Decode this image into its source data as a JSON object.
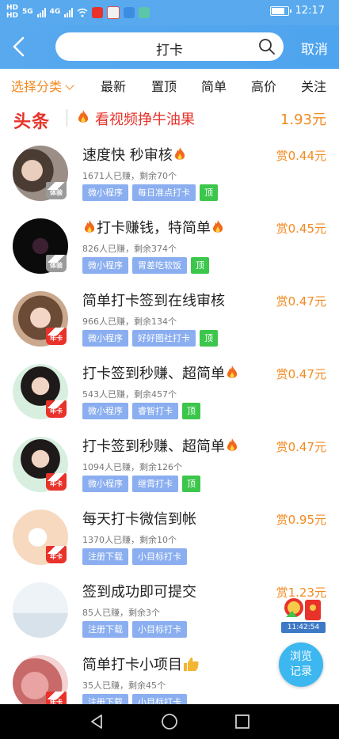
{
  "status_bar": {
    "sim1": "HD",
    "sim2": "HD",
    "net1": "5G",
    "net2": "4G",
    "time": "12:17"
  },
  "header": {
    "search_text": "打卡",
    "cancel_label": "取消"
  },
  "tabs": [
    {
      "label": "选择分类",
      "active": true
    },
    {
      "label": "最新"
    },
    {
      "label": "置顶"
    },
    {
      "label": "简单"
    },
    {
      "label": "高价"
    },
    {
      "label": "关注"
    }
  ],
  "headline": {
    "tag": "头条",
    "title": "看视频挣牛油果",
    "price": "1.93元"
  },
  "tasks": [
    {
      "title": "速度快 秒审核",
      "fire_after": true,
      "reward": "赏0.44元",
      "meta": "1671人已赚，剩余70个",
      "tags": [
        "微小程序",
        "每日准点打卡"
      ],
      "top": "顶",
      "badge": "体验",
      "badge_color": "gray"
    },
    {
      "title": "打卡赚钱，特简单",
      "fire_before": true,
      "fire_after": true,
      "reward": "赏0.45元",
      "meta": "826人已赚，剩余374个",
      "tags": [
        "微小程序",
        "胃差吃软饭"
      ],
      "top": "顶",
      "badge": "体验",
      "badge_color": "gray"
    },
    {
      "title": "简单打卡签到在线审核",
      "reward": "赏0.47元",
      "meta": "966人已赚，剩余134个",
      "tags": [
        "微小程序",
        "好好图社打卡"
      ],
      "top": "顶",
      "badge": "年卡",
      "badge_color": "red"
    },
    {
      "title": "打卡签到秒赚、超简单",
      "fire_after": true,
      "reward": "赏0.47元",
      "meta": "543人已赚，剩余457个",
      "tags": [
        "微小程序",
        "睿智打卡"
      ],
      "top": "顶",
      "badge": "年卡",
      "badge_color": "red"
    },
    {
      "title": "打卡签到秒赚、超简单",
      "fire_after": true,
      "reward": "赏0.47元",
      "meta": "1094人已赚，剩余126个",
      "tags": [
        "微小程序",
        "继霄打卡"
      ],
      "top": "顶",
      "badge": "年卡",
      "badge_color": "red"
    },
    {
      "title": "每天打卡微信到帐",
      "reward": "赏0.95元",
      "meta": "1370人已赚，剩余10个",
      "tags": [
        "注册下载",
        "小目标打卡"
      ],
      "badge": "年卡",
      "badge_color": "red"
    },
    {
      "title": "签到成功即可提交",
      "reward": "赏1.23元",
      "meta": "85人已赚，剩余3个",
      "tags": [
        "注册下载",
        "小目标打卡"
      ]
    },
    {
      "title": "简单打卡小项目",
      "thumb_after": true,
      "reward": "",
      "meta": "35人已赚，剩余45个",
      "tags": [
        "注册下载",
        "小目标打卡"
      ],
      "badge": "年卡",
      "badge_color": "red"
    }
  ],
  "float_gift": {
    "time": "11:42:54"
  },
  "float_history": {
    "line1": "浏览",
    "line2": "记录"
  }
}
